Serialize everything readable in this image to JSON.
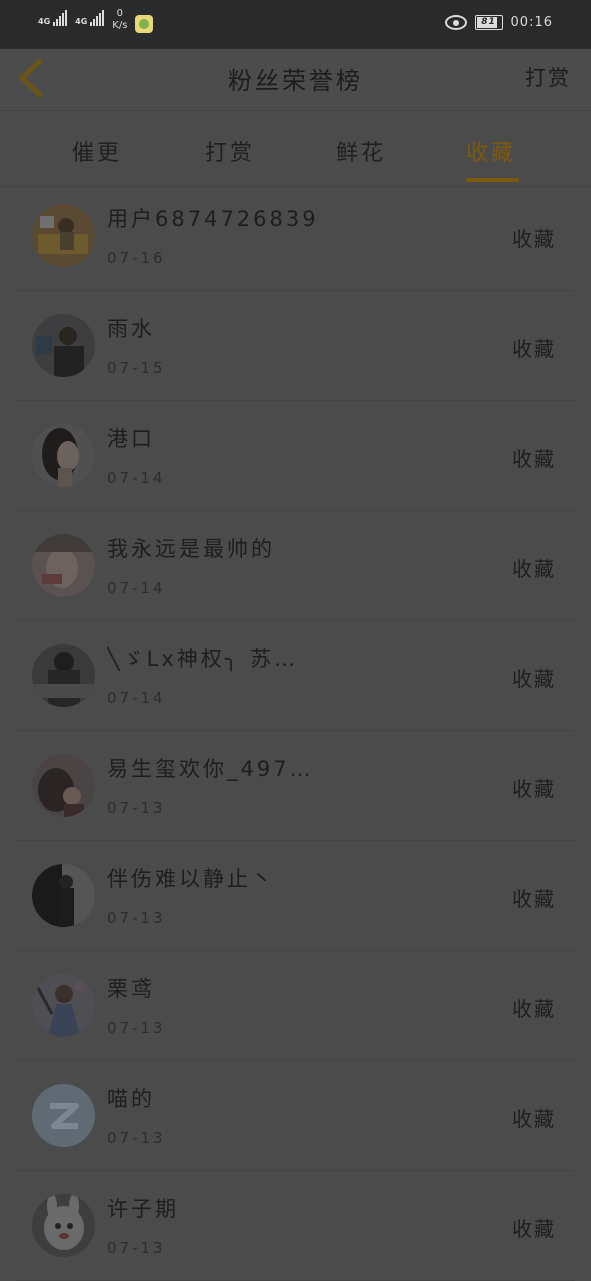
{
  "status_bar": {
    "network1": "4G",
    "network2": "4G",
    "speed_value": "0",
    "speed_unit": "K/s",
    "battery": "81",
    "time": "00:16"
  },
  "header": {
    "title": "粉丝荣誉榜",
    "right_action": "打赏"
  },
  "tabs": [
    {
      "label": "催更",
      "active": false
    },
    {
      "label": "打赏",
      "active": false
    },
    {
      "label": "鲜花",
      "active": false
    },
    {
      "label": "收藏",
      "active": true
    }
  ],
  "colors": {
    "accent": "#7b5a10",
    "background_overlay": "#4b4b4b"
  },
  "list": [
    {
      "name": "用户6874726839",
      "date": "07-16",
      "action": "收藏",
      "avatar": "photo-desk"
    },
    {
      "name": "雨水",
      "date": "07-15",
      "action": "收藏",
      "avatar": "photo-man"
    },
    {
      "name": "港口",
      "date": "07-14",
      "action": "收藏",
      "avatar": "photo-woman-profile"
    },
    {
      "name": "我永远是最帅的",
      "date": "07-14",
      "action": "收藏",
      "avatar": "photo-blur-face"
    },
    {
      "name": "╲ゞLx神权╮ 苏…",
      "date": "07-14",
      "action": "收藏",
      "avatar": "photo-dark-figure"
    },
    {
      "name": "易生玺欢你_497…",
      "date": "07-13",
      "action": "收藏",
      "avatar": "photo-couple"
    },
    {
      "name": "伴伤难以静止丶",
      "date": "07-13",
      "action": "收藏",
      "avatar": "photo-man-dark"
    },
    {
      "name": "栗鸢",
      "date": "07-13",
      "action": "收藏",
      "avatar": "anime-character"
    },
    {
      "name": "喵的",
      "date": "07-13",
      "action": "收藏",
      "avatar": "default-qq-avatar"
    },
    {
      "name": "许子期",
      "date": "07-13",
      "action": "收藏",
      "avatar": "cartoon-rabbit"
    }
  ]
}
